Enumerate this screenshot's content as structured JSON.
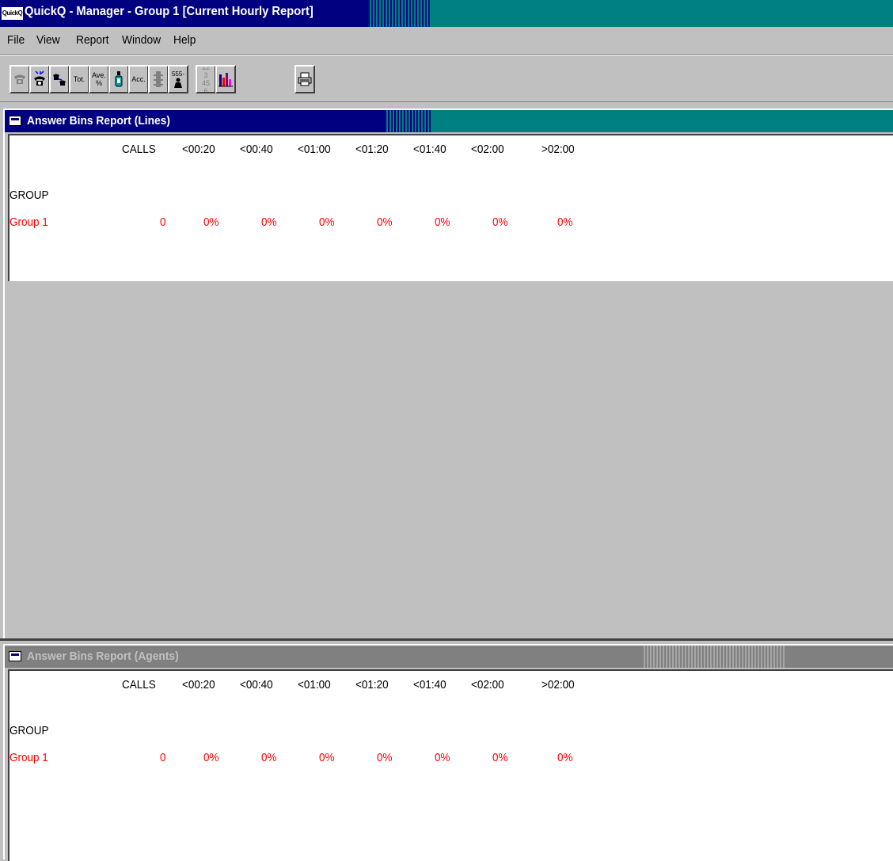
{
  "app": {
    "title": "QuickQ - Manager - Group 1 [Current Hourly Report]",
    "icon_text": "QuickQ",
    "colors": {
      "titlebar_active": "#000080",
      "titlebar_gradient_end": "#008080",
      "titlebar_inactive": "#808080",
      "value_text": "#ff0000"
    }
  },
  "menubar": {
    "items": [
      "File",
      "View",
      "Report",
      "Window",
      "Help"
    ]
  },
  "toolbar": {
    "buttons": [
      {
        "icon": "phone-gray-icon",
        "label": ""
      },
      {
        "icon": "phone-queue-icon",
        "label": ""
      },
      {
        "icon": "phone-transfer-icon",
        "label": ""
      },
      {
        "icon": "totals-icon",
        "label": "Tot."
      },
      {
        "icon": "average-percent-icon",
        "label": "Ave. %"
      },
      {
        "icon": "bottle-icon",
        "label": ""
      },
      {
        "icon": "accumulate-icon",
        "label": "Acc."
      },
      {
        "icon": "traffic-light-icon",
        "label": ""
      },
      {
        "icon": "agent-555-icon",
        "label": "555-"
      },
      {
        "icon": "numbers-123-456-icon",
        "label": "123 456"
      },
      {
        "icon": "bar-chart-icon",
        "label": ""
      },
      {
        "icon": "printer-icon",
        "label": ""
      }
    ]
  },
  "windows": [
    {
      "title": "Answer Bins Report (Lines)",
      "active": true,
      "columns": [
        "CALLS",
        "<00:20",
        "<00:40",
        "<01:00",
        "<01:20",
        "<01:40",
        "<02:00",
        ">02:00"
      ],
      "row_header": "GROUP",
      "rows": [
        {
          "name": "Group 1",
          "values": [
            "0",
            "0%",
            "0%",
            "0%",
            "0%",
            "0%",
            "0%",
            "0%"
          ]
        }
      ]
    },
    {
      "title": "Answer Bins Report (Agents)",
      "active": false,
      "columns": [
        "CALLS",
        "<00:20",
        "<00:40",
        "<01:00",
        "<01:20",
        "<01:40",
        "<02:00",
        ">02:00"
      ],
      "row_header": "GROUP",
      "rows": [
        {
          "name": "Group 1",
          "values": [
            "0",
            "0%",
            "0%",
            "0%",
            "0%",
            "0%",
            "0%",
            "0%"
          ]
        }
      ]
    }
  ]
}
